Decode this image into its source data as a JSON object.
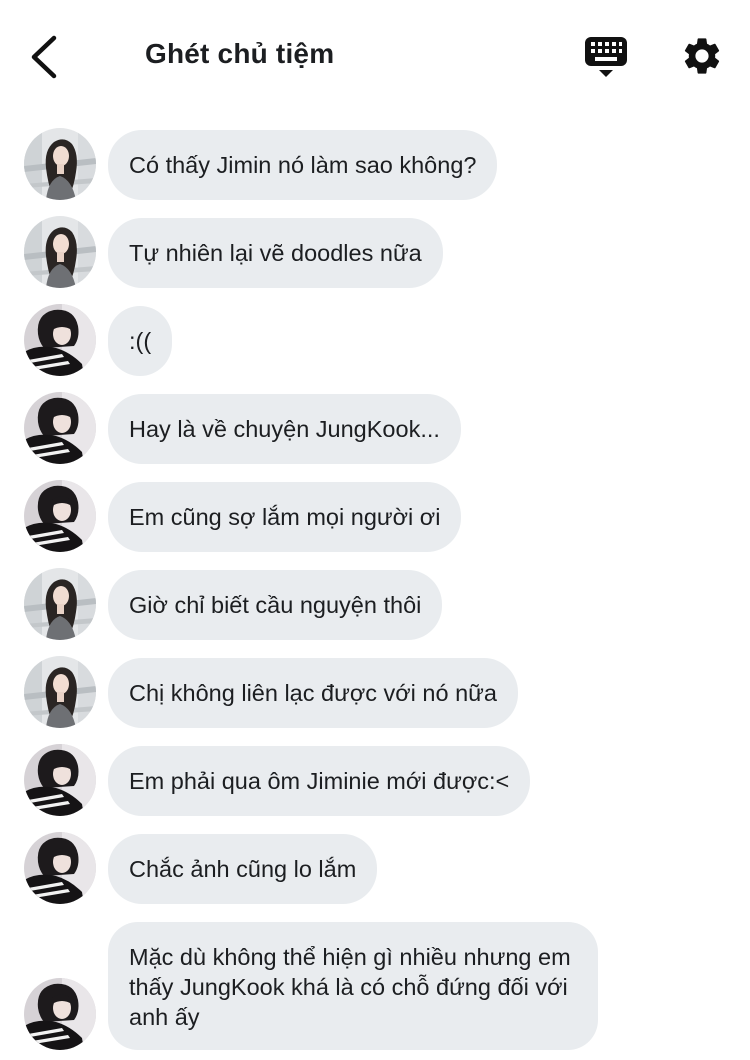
{
  "header": {
    "title": "Ghét chủ tiệm",
    "back_icon": "chevron-left-icon",
    "keyboard_icon": "keyboard-icon",
    "settings_icon": "gear-icon"
  },
  "colors": {
    "bubble": "#e9ecef",
    "text": "#1c1e21",
    "background": "#ffffff"
  },
  "messages": [
    {
      "avatar": "avatar-a",
      "text": "Có thấy Jimin nó làm sao không?"
    },
    {
      "avatar": "avatar-a",
      "text": "Tự nhiên lại vẽ doodles nữa"
    },
    {
      "avatar": "avatar-b",
      "text": ":(("
    },
    {
      "avatar": "avatar-b",
      "text": "Hay là về chuyện JungKook..."
    },
    {
      "avatar": "avatar-b",
      "text": "Em cũng sợ lắm mọi người ơi"
    },
    {
      "avatar": "avatar-a",
      "text": "Giờ chỉ biết cầu nguyện thôi"
    },
    {
      "avatar": "avatar-a",
      "text": "Chị không liên lạc được với nó nữa"
    },
    {
      "avatar": "avatar-b",
      "text": "Em phải qua ôm Jiminie mới được:<"
    },
    {
      "avatar": "avatar-b",
      "text": "Chắc ảnh cũng lo lắm"
    },
    {
      "avatar": "avatar-b",
      "text": "Mặc dù không thể hiện gì nhiều nhưng em thấy JungKook khá là có chỗ đứng đối với anh ấy"
    }
  ]
}
